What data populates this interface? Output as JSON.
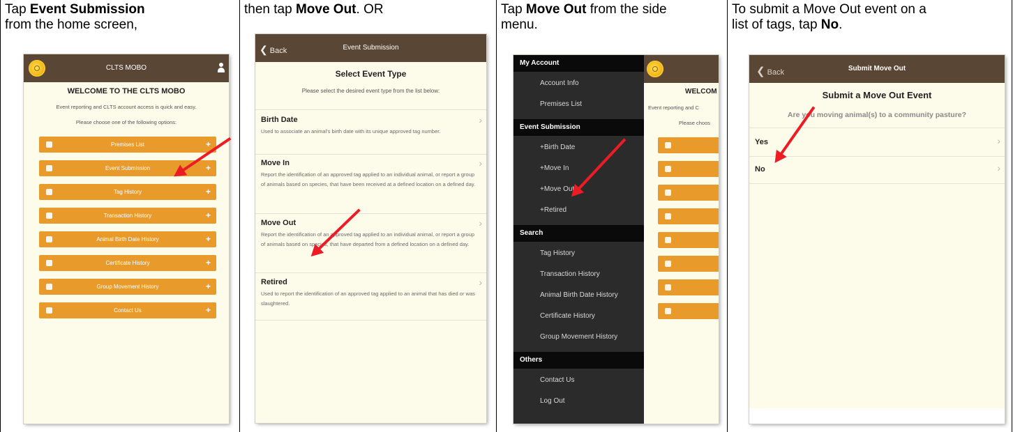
{
  "panels": [
    {
      "caption_lines": [
        [
          "Tap ",
          {
            "b": "Event Submission"
          }
        ],
        [
          "from the home screen,"
        ]
      ]
    },
    {
      "caption_lines": [
        [
          "then tap ",
          {
            "b": "Move Out"
          },
          ". OR"
        ]
      ]
    },
    {
      "caption_lines": [
        [
          "Tap ",
          {
            "b": "Move Out"
          },
          " from the side"
        ],
        [
          "menu."
        ]
      ]
    },
    {
      "caption_lines": [
        [
          "To submit a Move Out event on a"
        ],
        [
          "list of tags, tap ",
          {
            "b": "No"
          },
          "."
        ]
      ]
    }
  ],
  "home": {
    "title": "CLTS MOBO",
    "welcome": "WELCOME TO THE CLTS MOBO",
    "intro": "Event reporting and CLTS account access is quick and easy.",
    "prompt": "Please choose one of the following options:",
    "buttons": [
      "Premises List",
      "Event Submission",
      "Tag History",
      "Transaction History",
      "Animal Birth Date History",
      "Certificate History",
      "Group Movement History",
      "Contact Us"
    ]
  },
  "event_submission": {
    "back": "Back",
    "title": "Event Submission",
    "heading": "Select Event Type",
    "prompt": "Please select the desired event type from the list below:",
    "items": [
      {
        "title": "Birth Date",
        "desc": "Used to associate an animal's birth date with its unique approved tag number."
      },
      {
        "title": "Move In",
        "desc": "Report the identification of an approved tag applied to an individual animal, or report a group of animals based on species, that have been received at a defined location on a defined day."
      },
      {
        "title": "Move Out",
        "desc": "Report the identification of an approved tag applied to an individual animal, or report a group of animals based on species, that have departed from a defined location on a defined day."
      },
      {
        "title": "Retired",
        "desc": "Used to report the identification of an approved tag applied to an animal that has died or was slaughtered."
      }
    ]
  },
  "side_menu": {
    "sections": [
      {
        "header": "My Account",
        "items": [
          "Account Info",
          "Premises List"
        ]
      },
      {
        "header": "Event Submission",
        "items": [
          "+Birth Date",
          "+Move In",
          "+Move Out",
          "+Retired"
        ]
      },
      {
        "header": "Search",
        "items": [
          "Tag History",
          "Transaction History",
          "Animal Birth Date History",
          "Certificate History",
          "Group Movement History"
        ]
      },
      {
        "header": "Others",
        "items": [
          "Contact Us",
          "Log Out"
        ]
      }
    ],
    "behind": {
      "welcome": "WELCOM",
      "intro": "Event reporting and C",
      "prompt": "Please choos"
    }
  },
  "move_out": {
    "back": "Back",
    "title": "Submit Move Out",
    "heading": "Submit a Move Out Event",
    "question": "Are you moving animal(s) to a community pasture?",
    "options": [
      "Yes",
      "No"
    ]
  },
  "colors": {
    "header": "#5a4635",
    "button": "#e89a2a",
    "background": "#fdfbea",
    "arrow": "#ed1c24",
    "menu": "#2b2b2b"
  }
}
